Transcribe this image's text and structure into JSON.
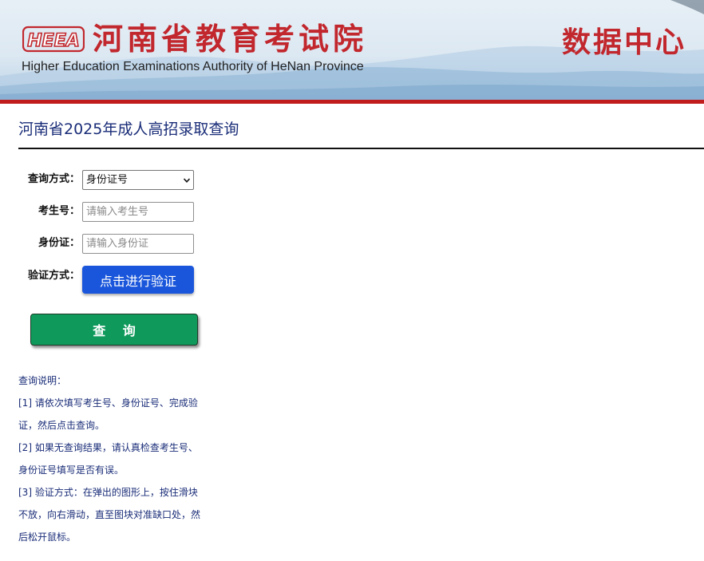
{
  "header": {
    "logo_text": "HEEA",
    "cn_title": "河南省教育考试院",
    "en_title": "Higher Education Examinations Authority of HeNan Province",
    "data_center": "数据中心",
    "colors": {
      "brand_red": "#c1272d",
      "bar_red": "#c11d1d"
    }
  },
  "page": {
    "title": "河南省2025年成人高招录取查询"
  },
  "form": {
    "query_method": {
      "label": "查询方式：",
      "selected": "身份证号"
    },
    "exam_number": {
      "label": "考生号：",
      "placeholder": "请输入考生号",
      "value": ""
    },
    "id_card": {
      "label": "身份证：",
      "placeholder": "请输入身份证",
      "value": ""
    },
    "verify": {
      "label": "验证方式：",
      "button_label": "点击进行验证",
      "color": "#1a56db"
    },
    "query_button_label": "查 询",
    "query_button_color": "#0f9a5b"
  },
  "notes": {
    "heading": "查询说明：",
    "items": [
      "[1] 请依次填写考生号、身份证号、完成验证，然后点击查询。",
      "[2] 如果无查询结果，请认真检查考生号、身份证号填写是否有误。",
      "[3] 验证方式：在弹出的图形上，按住滑块不放，向右滑动，直至图块对准缺口处，然后松开鼠标。"
    ]
  }
}
